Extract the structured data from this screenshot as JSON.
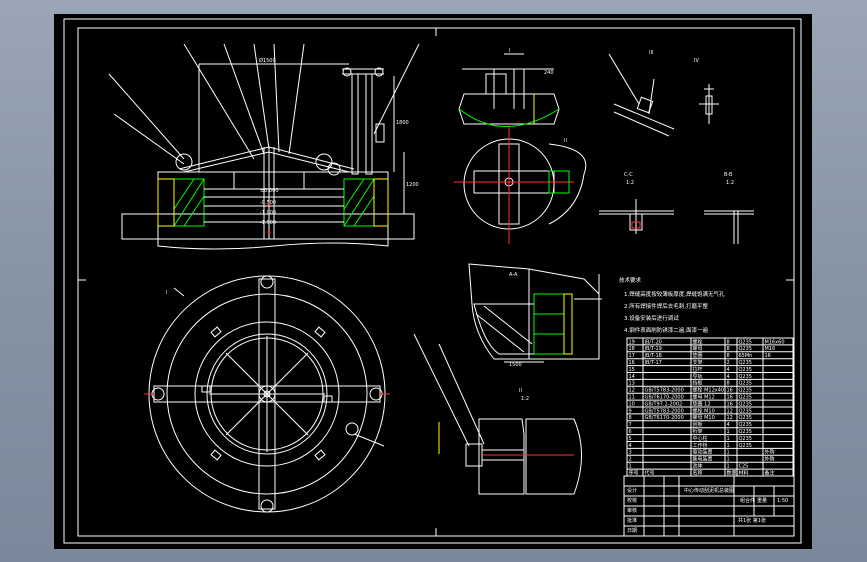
{
  "view_labels": {
    "section_a": "A-A",
    "section_b": "B-B",
    "section_c": "C-C",
    "detail_1": "I",
    "detail_2": "II",
    "detail_3": "III",
    "detail_4": "IV",
    "scale_label": "1:2"
  },
  "dimensions": {
    "top_width": "Ø1500",
    "height_1": "1800",
    "height_2": "1200",
    "elev_1": "±0.000",
    "elev_2": "-0.500",
    "elev_3": "-1.000",
    "elev_4": "-1.500"
  },
  "notes": {
    "heading": "技术要求",
    "lines": [
      "1.焊缝高度按较薄板厚度,焊缝饱满无气孔",
      "2.所有焊接件焊后去毛刺,打磨平整",
      "3.设备安装后进行调试",
      "4.钢件表面刷防锈漆二遍,面漆一遍"
    ]
  },
  "parts_list": {
    "headers": [
      "序号",
      "代号",
      "名称",
      "数量",
      "材料",
      "备注"
    ],
    "rows": [
      [
        "19",
        "JB/T-20",
        "螺栓",
        "8",
        "Q235",
        "M16x60"
      ],
      [
        "18",
        "JB/T-19",
        "螺母",
        "8",
        "Q235",
        "M16"
      ],
      [
        "17",
        "JB/T-18",
        "垫圈",
        "8",
        "65Mn",
        "16"
      ],
      [
        "16",
        "JB/T-17",
        "支架",
        "2",
        "Q235",
        ""
      ],
      [
        "15",
        "",
        "拉杆",
        "4",
        "Q235",
        ""
      ],
      [
        "14",
        "",
        "导轨",
        "4",
        "Q235",
        ""
      ],
      [
        "13",
        "",
        "挡板",
        "8",
        "Q235",
        ""
      ],
      [
        "12",
        "GB/T5783-2000",
        "螺栓 M12x40",
        "16",
        "Q235",
        ""
      ],
      [
        "11",
        "GB/T6170-2000",
        "螺母 M12",
        "16",
        "Q235",
        ""
      ],
      [
        "10",
        "GB/T97.1-2002",
        "垫圈 12",
        "16",
        "Q235",
        ""
      ],
      [
        "9",
        "GB/T5783-2000",
        "螺栓 M10",
        "12",
        "Q235",
        ""
      ],
      [
        "8",
        "GB/T6170-2000",
        "螺母 M10",
        "12",
        "Q235",
        ""
      ],
      [
        "7",
        "",
        "刮板",
        "4",
        "Q235",
        ""
      ],
      [
        "6",
        "",
        "桁架",
        "1",
        "Q235",
        ""
      ],
      [
        "5",
        "",
        "中心柱",
        "1",
        "Q235",
        ""
      ],
      [
        "4",
        "",
        "工作桥",
        "1",
        "Q235",
        ""
      ],
      [
        "3",
        "",
        "驱动装置",
        "1",
        "",
        "外购"
      ],
      [
        "2",
        "",
        "集电装置",
        "1",
        "",
        "外购"
      ],
      [
        "1",
        "",
        "池体",
        "1",
        "C25",
        ""
      ]
    ]
  },
  "title_block": {
    "drawing_title": "中心传动刮泥机总装图",
    "scale": "1:50",
    "sheet": "共1张 第1张",
    "labels": [
      "设计",
      "校核",
      "审核",
      "批准",
      "日期"
    ],
    "material": "组合件",
    "weight": "重量"
  }
}
